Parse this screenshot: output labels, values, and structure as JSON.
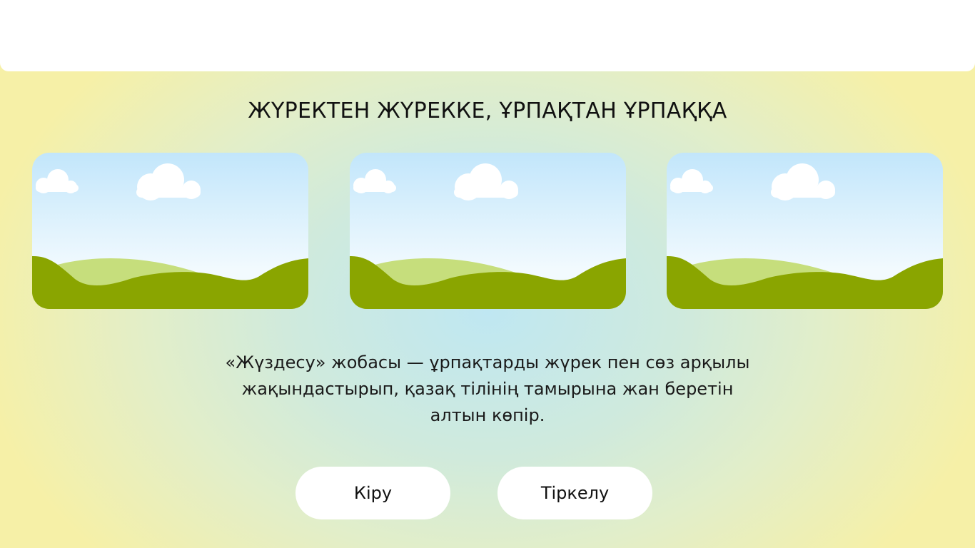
{
  "header": {
    "title": "ЖҮРЕКТЕН ЖҮРЕККЕ, ҰРПАҚТАН ҰРПАҚҚА"
  },
  "gallery": {
    "images": [
      {
        "alt": "landscape-image-placeholder"
      },
      {
        "alt": "landscape-image-placeholder"
      },
      {
        "alt": "landscape-image-placeholder"
      }
    ],
    "colors": {
      "sky_top": "#c2e6fb",
      "sky_bottom": "#f2fafe",
      "hill_light": "#c6de7c",
      "hill_dark": "#8aa500",
      "cloud": "#ffffff"
    }
  },
  "description": {
    "text": "«Жүздесу» жобасы — ұрпақтарды жүрек пен сөз арқылы жақындастырып, қазақ тілінің тамырына жан беретін алтын көпір."
  },
  "actions": {
    "login_label": "Кіру",
    "register_label": "Тіркелу"
  }
}
